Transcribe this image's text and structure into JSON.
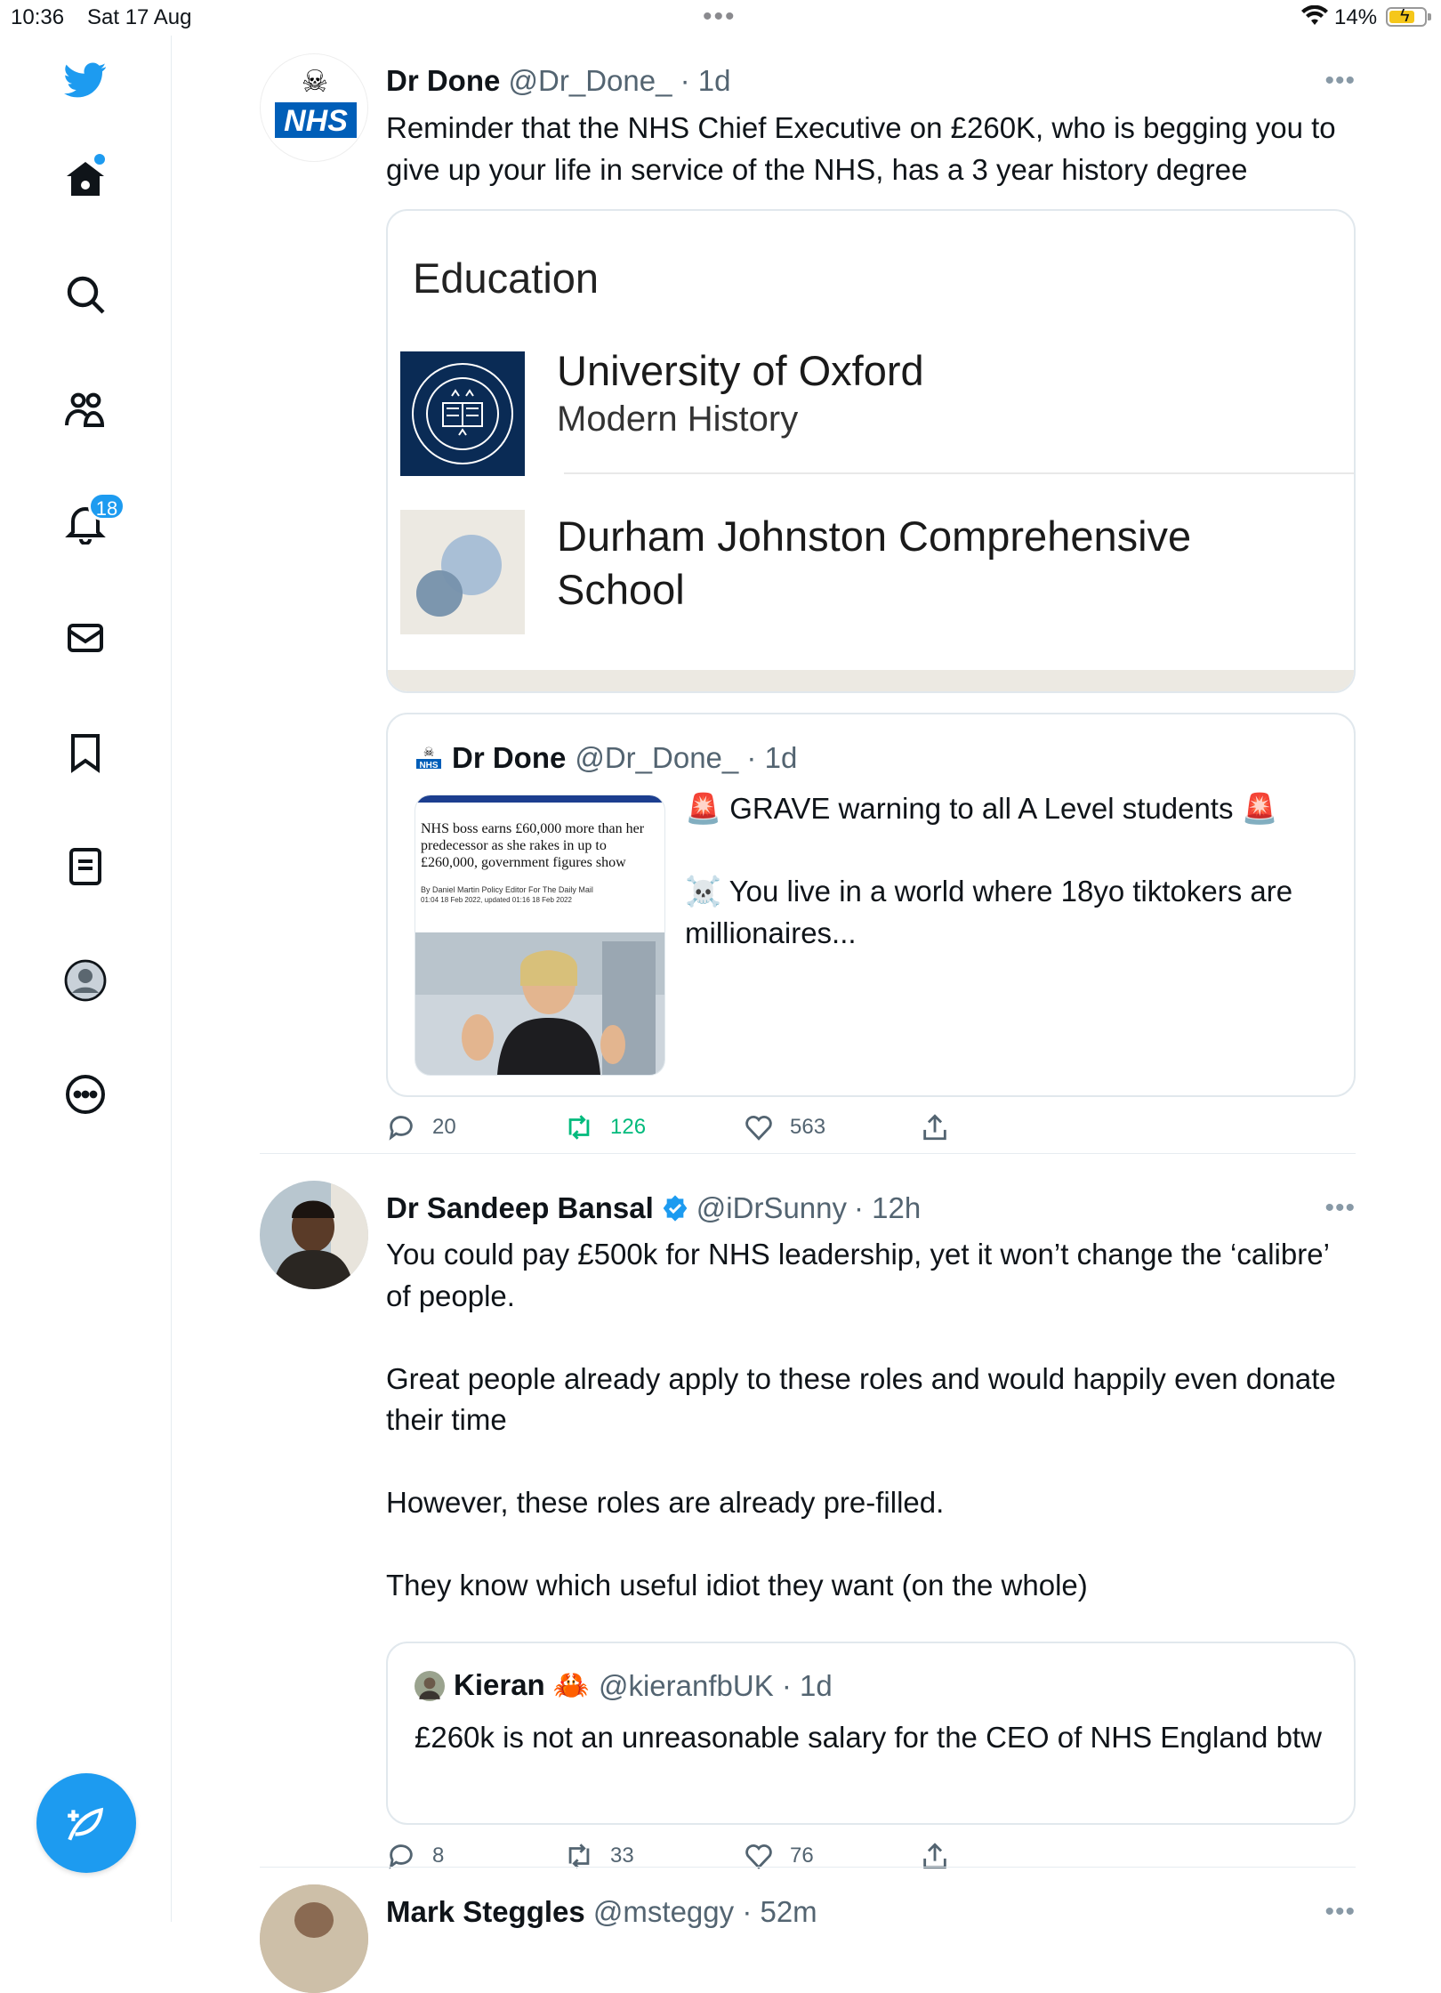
{
  "status_bar": {
    "time": "10:36",
    "date": "Sat 17 Aug",
    "battery": "14%"
  },
  "sidebar": {
    "notifications_count": "18"
  },
  "tweets": [
    {
      "name": "Dr Done",
      "handle": "@Dr_Done_",
      "time": "· 1d",
      "text": "Reminder that the NHS Chief Executive on £260K, who is begging you to give up your life in service of the NHS, has a 3 year history degree",
      "card": {
        "title": "Education",
        "items": [
          {
            "name": "University of Oxford",
            "sub": "Modern History"
          },
          {
            "name": "Durham Johnston Comprehensive School",
            "sub": ""
          }
        ]
      },
      "quote": {
        "name": "Dr Done",
        "handle": "@Dr_Done_ · 1d",
        "article_headline": "NHS boss earns £60,000 more than her predecessor as she rakes in up to £260,000, government figures show",
        "article_byline": "By Daniel Martin Policy Editor For The Daily Mail",
        "article_date": "01:04 18 Feb 2022, updated 01:16 18 Feb 2022",
        "line1": "🚨 GRAVE warning to all A Level students  🚨",
        "line2": "☠️ You live in a world where 18yo tiktokers are millionaires..."
      },
      "stats": {
        "replies": "20",
        "retweets": "126",
        "likes": "563"
      }
    },
    {
      "name": "Dr Sandeep Bansal",
      "handle": "@iDrSunny",
      "time": "· 12h",
      "text": "You could pay £500k for NHS leadership, yet it won’t change the ‘calibre’ of people.\n\nGreat people already apply to these roles and would happily even donate their time\n\nHowever, these roles are already pre-filled.\n\nThey know which useful idiot they want (on the whole)",
      "quote": {
        "name": "Kieran 🦀",
        "handle": "@kieranfbUK · 1d",
        "text": "£260k is not an unreasonable salary for the CEO of NHS England btw"
      },
      "stats": {
        "replies": "8",
        "retweets": "33",
        "likes": "76"
      }
    },
    {
      "name": "Mark Steggles",
      "handle": "@msteggy",
      "time": "· 52m"
    }
  ],
  "colors": {
    "accent": "#1d9bf0",
    "retweet": "#00ba7c",
    "oxford": "#0a2b55"
  }
}
